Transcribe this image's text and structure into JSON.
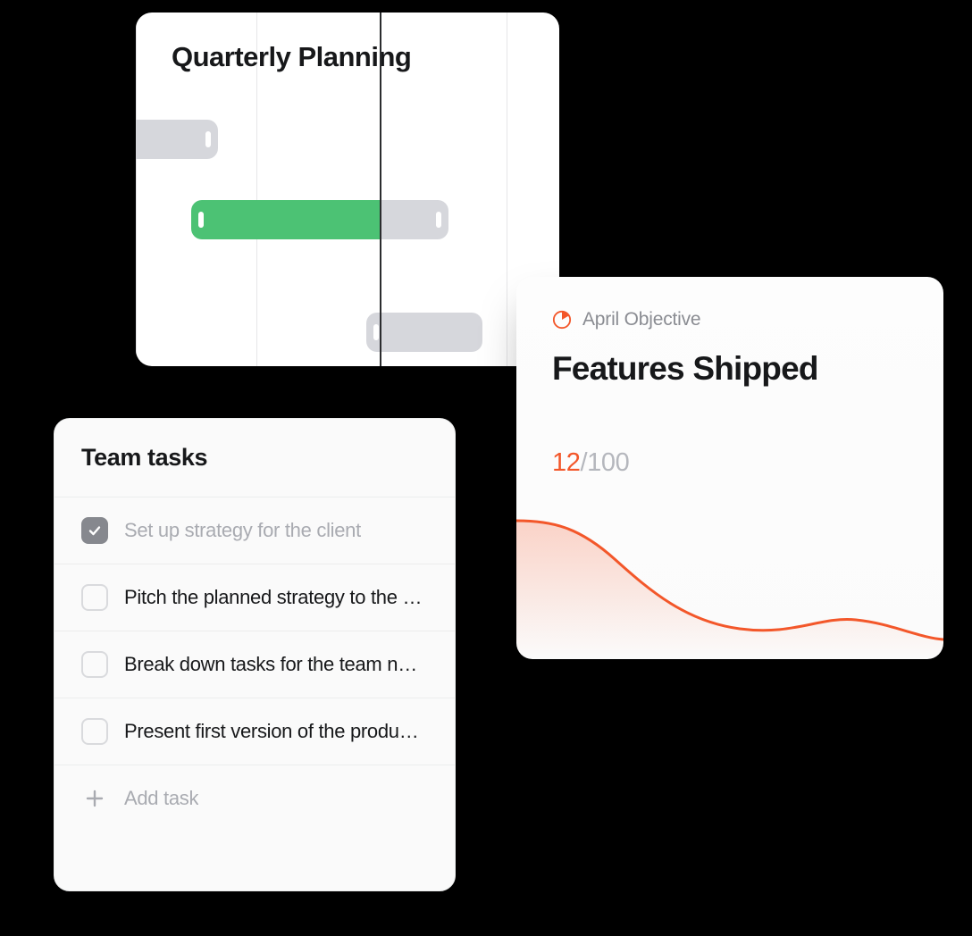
{
  "gantt": {
    "title": "Quarterly Planning"
  },
  "objective": {
    "label": "April Objective",
    "title": "Features Shipped",
    "progress": {
      "current": "12",
      "separator": "/",
      "total": "100"
    }
  },
  "tasks": {
    "title": "Team tasks",
    "items": [
      {
        "label": "Set up strategy for the client",
        "done": true
      },
      {
        "label": "Pitch the planned strategy to the client",
        "done": false
      },
      {
        "label": "Break down tasks for the team next sprint",
        "done": false
      },
      {
        "label": "Present first version of the product roadmap",
        "done": false
      }
    ],
    "add_label": "Add task"
  }
}
